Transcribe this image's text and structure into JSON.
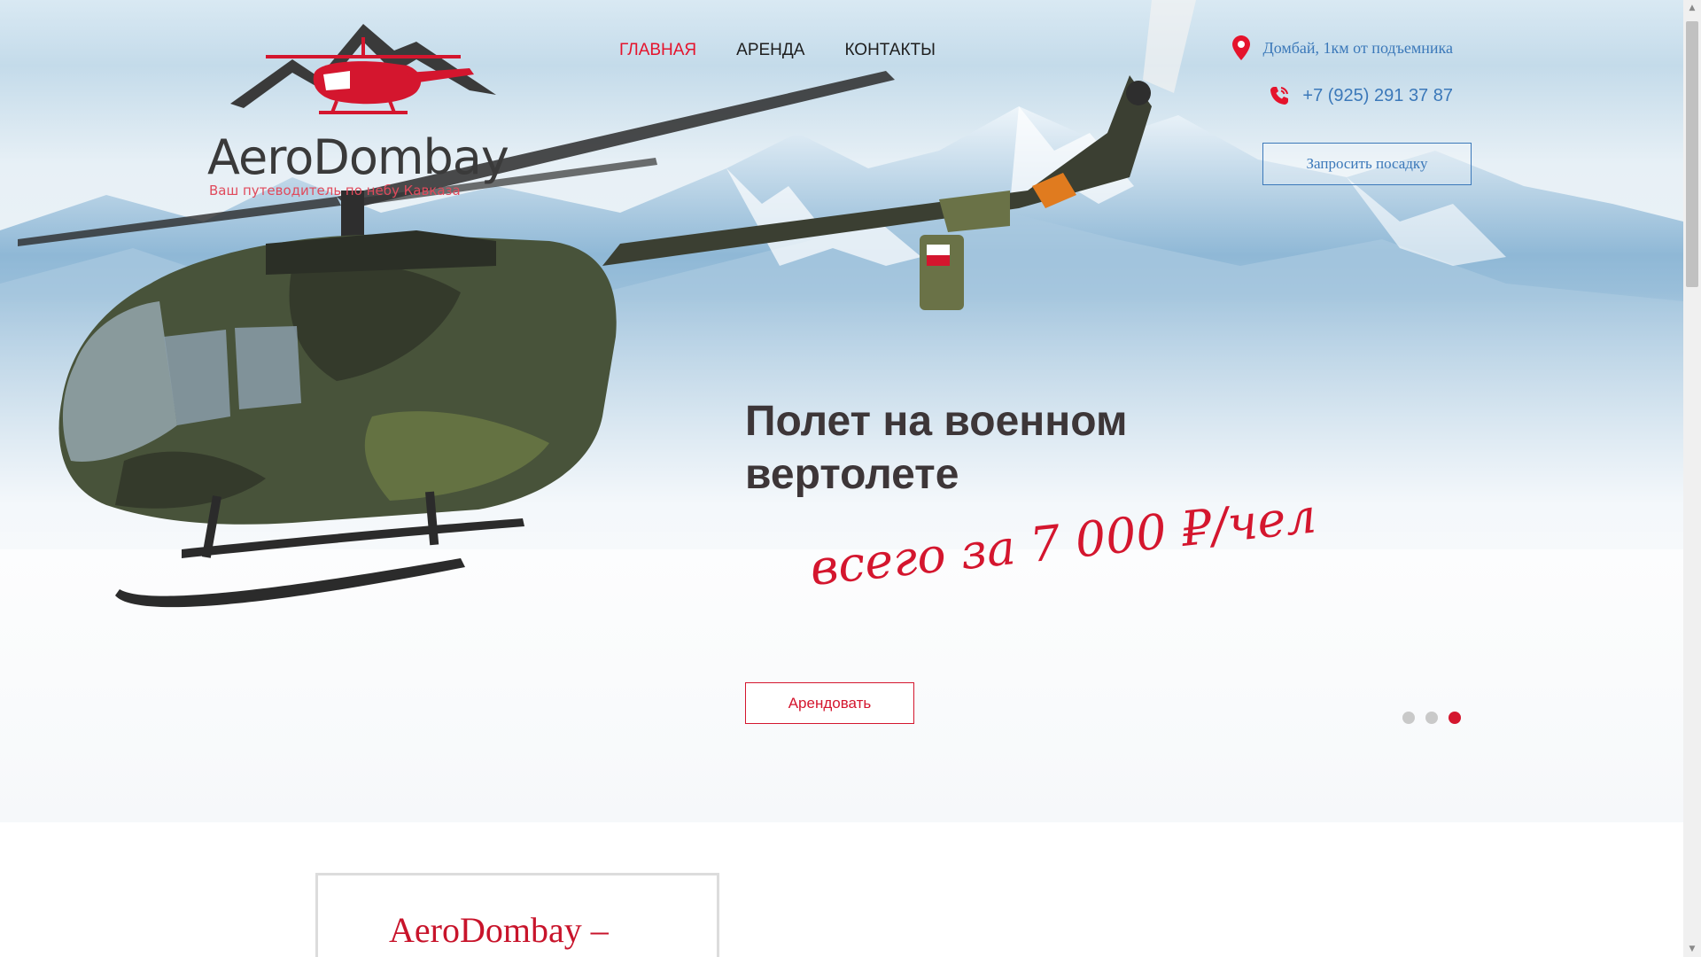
{
  "logo": {
    "title": "AeroDombay",
    "tagline": "Ваш путеводитель по небу Кавказа"
  },
  "nav": {
    "items": [
      {
        "label": "ГЛАВНАЯ",
        "active": true
      },
      {
        "label": "АРЕНДА",
        "active": false
      },
      {
        "label": "КОНТАКТЫ",
        "active": false
      }
    ]
  },
  "contacts": {
    "address": "Домбай, 1км от подъемника",
    "address_icon": "map-pin-icon",
    "phone": "+7 (925) 291 37 87",
    "phone_icon": "phone-icon",
    "request_button": "Запросить посадку"
  },
  "slide": {
    "title": "Полет на военном вертолете",
    "price": "всего за 7 000 ₽/чел",
    "rent_button": "Арендовать"
  },
  "slider": {
    "total": 3,
    "active_index": 3
  },
  "about": {
    "title": "AeroDombay –"
  },
  "colors": {
    "accent_red": "#d4162e",
    "link_blue": "#3b78b9",
    "title_dark": "#3d3638"
  }
}
